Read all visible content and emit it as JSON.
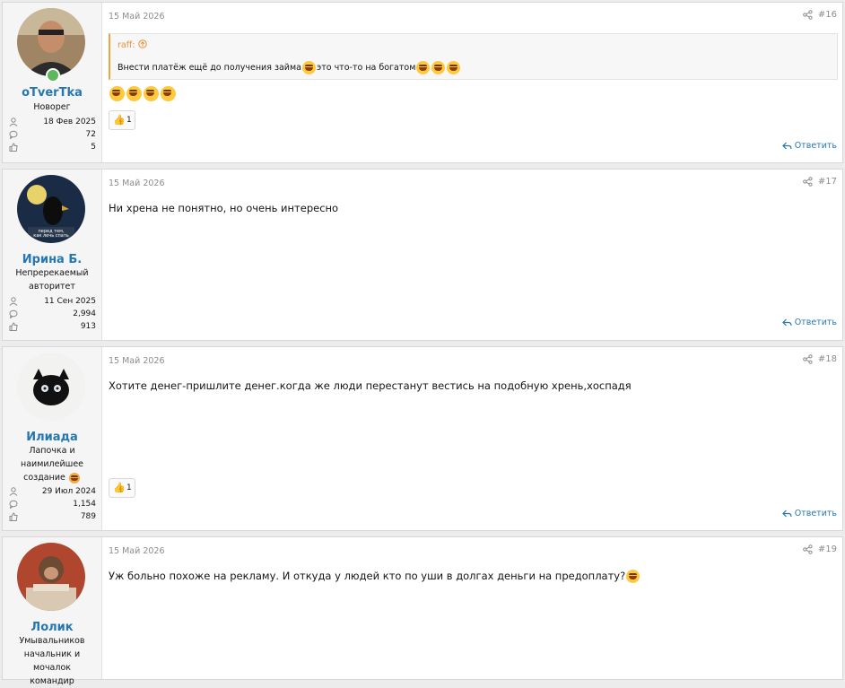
{
  "colors": {
    "link": "#2577b1",
    "quote_author": "#e8903a",
    "online": "#5cb85c"
  },
  "posts": [
    {
      "username": "oTverTka",
      "user_title": "Новорег",
      "joined": "18 Фев 2025",
      "messages": "72",
      "reactions": "5",
      "date": "15 Май 2026",
      "number": "#16",
      "quote_author": "raff:",
      "quote_text_1": "Внести платёж ещё до получения займа",
      "quote_text_2": "это что-то на богатом",
      "text": "",
      "reaction_count": "1",
      "reply_label": "Ответить"
    },
    {
      "username": "Ирина Б.",
      "user_title_line1": "Непререкаемый",
      "user_title_line2": "авторитет",
      "joined": "11 Сен 2025",
      "messages": "2,994",
      "reactions": "913",
      "date": "15 Май 2026",
      "number": "#17",
      "text": "Ни хрена не понятно, но очень интересно",
      "reply_label": "Ответить"
    },
    {
      "username": "Илиада",
      "user_title_line1": "Лапочка и",
      "user_title_line2": "наимилейшее",
      "user_title_line3": "создание",
      "joined": "29 Июл 2024",
      "messages": "1,154",
      "reactions": "789",
      "date": "15 Май 2026",
      "number": "#18",
      "text": "Хотите денег-пришлите денег.когда же люди перестанут вестись на подобную хрень,хоспадя",
      "reaction_count": "1",
      "reply_label": "Ответить"
    },
    {
      "username": "Лолик",
      "user_title_line1": "Умывальников",
      "user_title_line2": "начальник и мочалок",
      "user_title_line3": "командир",
      "date": "15 Май 2026",
      "number": "#19",
      "text": "Уж больно похоже на рекламу. И откуда у людей кто по уши в долгах деньги на предоплату?"
    }
  ]
}
